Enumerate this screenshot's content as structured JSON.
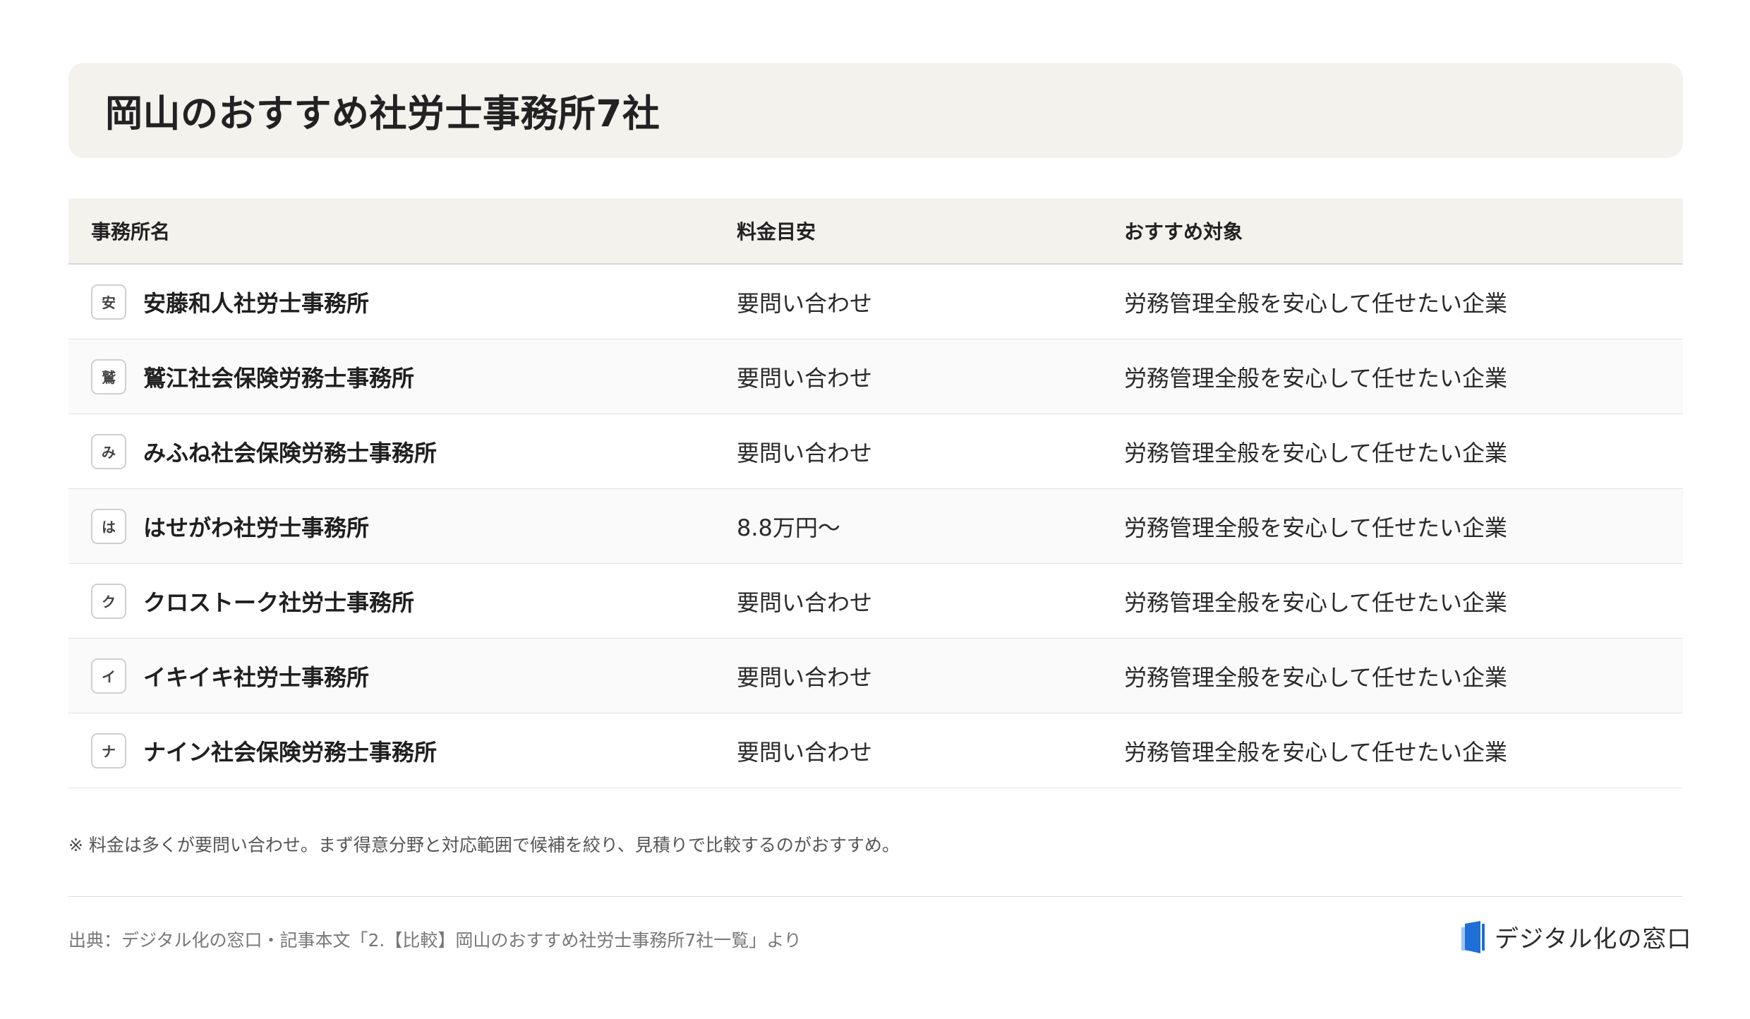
{
  "title": "岡山のおすすめ社労士事務所7社",
  "table": {
    "headers": {
      "name": "事務所名",
      "fee": "料金目安",
      "target": "おすすめ対象"
    },
    "rows": [
      {
        "badge": "安",
        "name": "安藤和人社労士事務所",
        "fee": "要問い合わせ",
        "target": "労務管理全般を安心して任せたい企業"
      },
      {
        "badge": "鷲",
        "name": "鷲江社会保険労務士事務所",
        "fee": "要問い合わせ",
        "target": "労務管理全般を安心して任せたい企業"
      },
      {
        "badge": "み",
        "name": "みふね社会保険労務士事務所",
        "fee": "要問い合わせ",
        "target": "労務管理全般を安心して任せたい企業"
      },
      {
        "badge": "は",
        "name": "はせがわ社労士事務所",
        "fee": "8.8万円〜",
        "target": "労務管理全般を安心して任せたい企業"
      },
      {
        "badge": "ク",
        "name": "クロストーク社労士事務所",
        "fee": "要問い合わせ",
        "target": "労務管理全般を安心して任せたい企業"
      },
      {
        "badge": "イ",
        "name": "イキイキ社労士事務所",
        "fee": "要問い合わせ",
        "target": "労務管理全般を安心して任せたい企業"
      },
      {
        "badge": "ナ",
        "name": "ナイン社会保険労務士事務所",
        "fee": "要問い合わせ",
        "target": "労務管理全般を安心して任せたい企業"
      }
    ]
  },
  "note": "※ 料金は多くが要問い合わせ。まず得意分野と対応範囲で候補を絞り、見積りで比較するのがおすすめ。",
  "source": "出典：デジタル化の窓口・記事本文「2.【比較】岡山のおすすめ社労士事務所7社一覧」より",
  "logo": {
    "text": "デジタル化の窓口",
    "icon": "door-logo-icon",
    "accent": "#1f6fd6"
  }
}
